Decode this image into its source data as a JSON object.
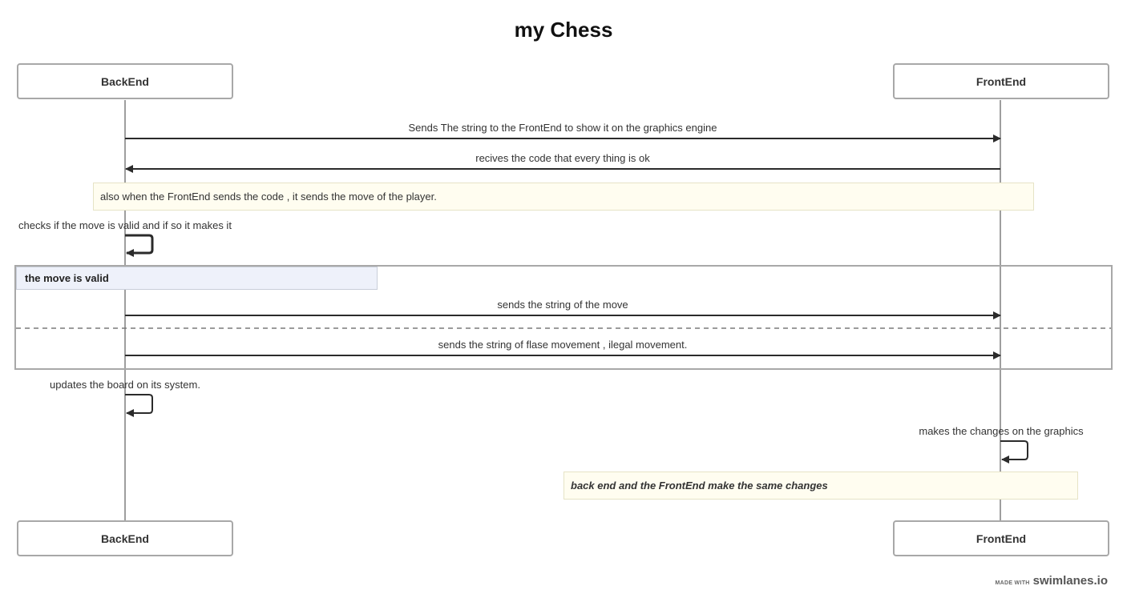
{
  "diagram": {
    "title": "my Chess",
    "actors": [
      {
        "name": "BackEnd"
      },
      {
        "name": "FrontEnd"
      }
    ],
    "messages": [
      {
        "from": "BackEnd",
        "to": "FrontEnd",
        "label": "Sends The string to the FrontEnd to show it on the graphics engine"
      },
      {
        "from": "FrontEnd",
        "to": "BackEnd",
        "label": "recives the code that every thing is ok"
      },
      {
        "type": "note",
        "label": "also when the FrontEnd sends the code , it sends the move of the player."
      },
      {
        "from": "BackEnd",
        "to": "BackEnd",
        "label": "checks if the move is valid and if so it makes it"
      },
      {
        "type": "condition",
        "label": "the move is valid"
      },
      {
        "from": "BackEnd",
        "to": "FrontEnd",
        "label": "sends the string of the move"
      },
      {
        "from": "BackEnd",
        "to": "FrontEnd",
        "label": "sends the string of flase movement , ilegal movement."
      },
      {
        "from": "BackEnd",
        "to": "BackEnd",
        "label": "updates the board on its system."
      },
      {
        "from": "FrontEnd",
        "to": "FrontEnd",
        "label": "makes the changes on the graphics"
      },
      {
        "type": "note",
        "label": "back end and the FrontEnd make the same changes"
      }
    ]
  },
  "footer": {
    "made_with": "MADE WITH",
    "brand": "swimlanes.io"
  }
}
